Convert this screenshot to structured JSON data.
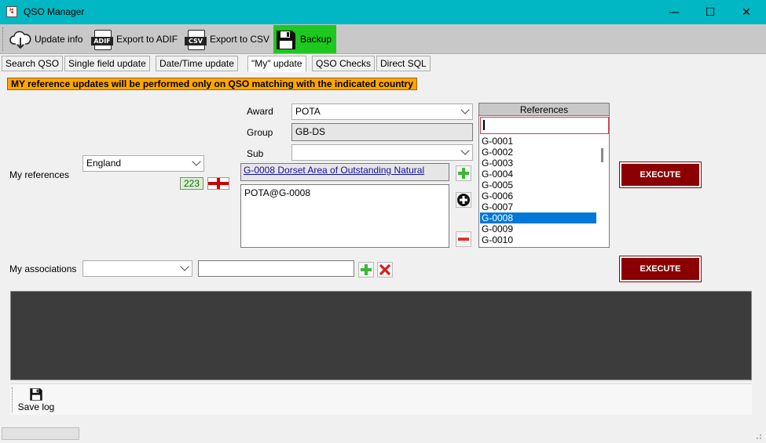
{
  "window": {
    "title": "QSO Manager",
    "minimize_glyph": "—",
    "maximize_glyph": "☐",
    "close_glyph": "✕"
  },
  "toolbar": {
    "update_info_label": "Update info",
    "export_adif_label": "Export to ADIF",
    "export_adif_icon_text": "ADIF",
    "export_csv_label": "Export to CSV",
    "export_csv_icon_text": "CSV",
    "backup_label": "Backup"
  },
  "tabs": [
    {
      "label": "Search QSO"
    },
    {
      "label": "Single field update"
    },
    {
      "label": "Date/Time update"
    },
    {
      "label": "\"My\" update",
      "active": true
    },
    {
      "label": "QSO Checks"
    },
    {
      "label": "Direct SQL"
    }
  ],
  "notice": "MY reference updates will be performed only on QSO matching with the indicated country",
  "my_references": {
    "label": "My references",
    "country": "England",
    "dxcc_code": "223",
    "award_label": "Award",
    "award_value": "POTA",
    "group_label": "Group",
    "group_value": "GB-DS",
    "sub_label": "Sub",
    "sub_value": "",
    "selected_reference_link": "G-0008 Dorset Area of Outstanding Natural",
    "references_text": "POTA@G-0008",
    "execute_label": "EXECUTE"
  },
  "references_panel": {
    "header": "References",
    "search_value": "",
    "items": [
      "G-0001",
      "G-0002",
      "G-0003",
      "G-0004",
      "G-0005",
      "G-0006",
      "G-0007",
      "G-0008",
      "G-0009",
      "G-0010"
    ],
    "selected": "G-0008"
  },
  "my_associations": {
    "label": "My associations",
    "combo_value": "",
    "text_value": "",
    "execute_label": "EXECUTE"
  },
  "bottom": {
    "save_log_label": "Save log"
  },
  "colors": {
    "titlebar": "#00b7c3",
    "backup_highlight": "#1ec81e",
    "notice_bg": "#ffa500",
    "execute_bg": "#8b0000",
    "selection": "#0078d7"
  }
}
